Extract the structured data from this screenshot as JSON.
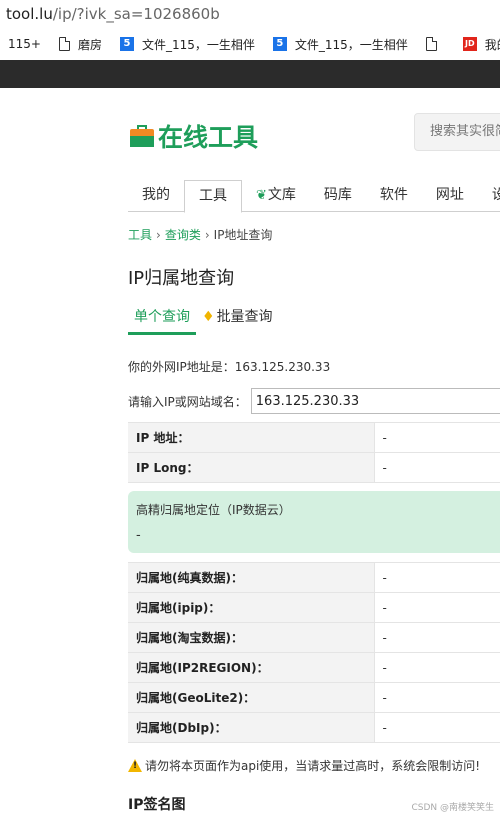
{
  "browser": {
    "url_domain": "tool.lu",
    "url_path": "/ip/?ivk_sa=1026860b",
    "bookmarks": [
      {
        "icon": "none",
        "label": "115+"
      },
      {
        "icon": "doc-icon",
        "label": "磨房"
      },
      {
        "icon": "five-icon",
        "badge": "5",
        "label": "文件_115，一生相伴"
      },
      {
        "icon": "five-icon",
        "badge": "5",
        "label": "文件_115，一生相伴"
      },
      {
        "icon": "doc-icon",
        "label": ""
      },
      {
        "icon": "jd-icon",
        "badge": "JD",
        "label": "我的京东"
      }
    ]
  },
  "site": {
    "logo_text": "在线工具",
    "search_placeholder": "搜索其实很简单"
  },
  "nav": {
    "tabs": [
      "我的",
      "工具",
      "文库",
      "码库",
      "软件",
      "网址",
      "设"
    ],
    "active": "工具"
  },
  "breadcrumb": {
    "items": [
      "工具",
      "查询类",
      "IP地址查询"
    ],
    "separator": "›"
  },
  "page": {
    "title": "IP归属地查询",
    "subtabs": [
      "单个查询",
      "批量查询"
    ],
    "my_ip_text": "你的外网IP地址是：163.125.230.33",
    "input_label": "请输入IP或网站域名：",
    "input_value": "163.125.230.33"
  },
  "table_top": [
    {
      "key": "IP 地址：",
      "value": "-"
    },
    {
      "key": "IP Long：",
      "value": "-"
    }
  ],
  "highlight": {
    "label": "高精归属地定位（IP数据云）",
    "value": "-"
  },
  "table_bottom": [
    {
      "key": "归属地(纯真数据)：",
      "value": "-"
    },
    {
      "key": "归属地(ipip)：",
      "value": "-"
    },
    {
      "key": "归属地(淘宝数据)：",
      "value": "-"
    },
    {
      "key": "归属地(IP2REGION)：",
      "value": "-"
    },
    {
      "key": "归属地(GeoLite2)：",
      "value": "-"
    },
    {
      "key": "归属地(DbIp)：",
      "value": "-"
    }
  ],
  "warning": {
    "text": "请勿将本页面作为api使用，当请求量过高时，系统会限制访问!"
  },
  "section": {
    "title": "IP签名图"
  },
  "watermark": "CSDN @南楼笑笑生",
  "colors": {
    "brand_green": "#1e9e5a",
    "highlight_bg": "#d4f0e0",
    "warning_yellow": "#f2b600"
  }
}
